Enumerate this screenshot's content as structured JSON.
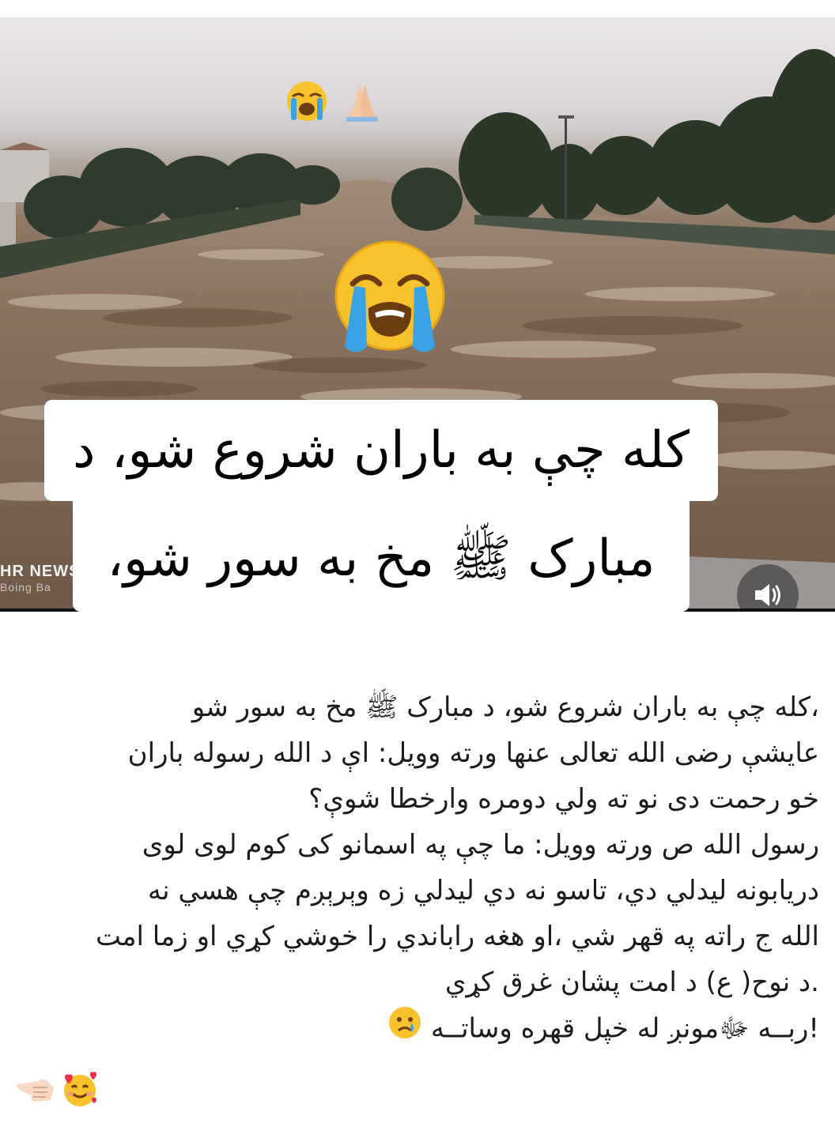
{
  "media": {
    "top_emojis": [
      "loudly-crying-face",
      "folded-hands"
    ],
    "center_emoji": "loudly-crying-face",
    "watermark_main": "HR NEWSA",
    "watermark_sub": "Boing Ba",
    "caption_line_1": "کله چې به باران شروع شو، د",
    "caption_line_2": "مبارک ﷺ مخ به سور شو،",
    "mute_button_icon": "speaker-icon"
  },
  "post": {
    "lines": [
      "،کله چې به باران شروع شو، د مبارک ﷺ مخ به سور شو",
      "عایشې رضی الله تعالی عنها ورته وویل: اې د الله رسوله باران",
      "خو رحمت دی نو ته ولي دومره وارخطا شوې؟",
      "رسول الله ص ورته وویل: ما چې په اسمانو کی کوم لوی لوی",
      "دریابونه لیدلي دي، تاسو نه دي لیدلي زه وېرېږم چې هسي نه",
      "الله ج راته په قهر شي ،او هغه راباندي را خوشي کړي او زما امت",
      ".د نوح( ع) د امت پشان غرق کړي",
      "!ربــه ﷻمونږ له خپل  قهره وساتــه"
    ],
    "line_8_emoji": "crying-face",
    "tail_emojis": [
      "backhand-index-pointing-left",
      "smiling-face-with-hearts"
    ]
  },
  "colors": {
    "flood_water": "#7d6755",
    "sky": "#e6e3e5",
    "caption_bg": "#ffffff",
    "emoji_yellow": "#f7c22c",
    "tear_blue": "#3aa3e6"
  }
}
